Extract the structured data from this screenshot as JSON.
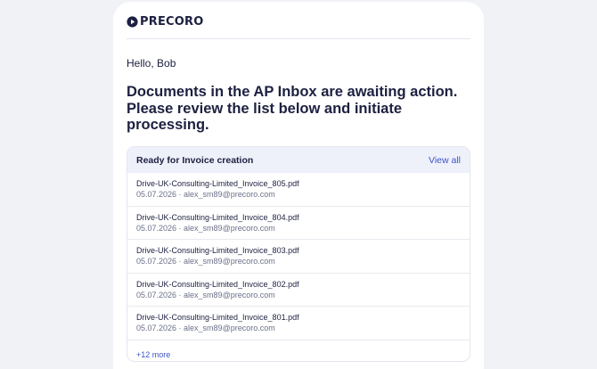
{
  "brand": {
    "name": "PRECORO",
    "logo_icon": "play-circle-icon"
  },
  "email": {
    "greeting": "Hello, Bob",
    "headline": "Documents in the AP Inbox are awaiting action. Please review the list below and initiate processing."
  },
  "panel": {
    "title": "Ready for Invoice creation",
    "view_all_label": "View all",
    "documents": [
      {
        "name": "Drive-UK-Consulting-Limited_Invoice_805.pdf",
        "meta": "05.07.2026 · alex_sm89@precoro.com"
      },
      {
        "name": "Drive-UK-Consulting-Limited_Invoice_804.pdf",
        "meta": "05.07.2026 · alex_sm89@precoro.com"
      },
      {
        "name": "Drive-UK-Consulting-Limited_Invoice_803.pdf",
        "meta": "05.07.2026 · alex_sm89@precoro.com"
      },
      {
        "name": "Drive-UK-Consulting-Limited_Invoice_802.pdf",
        "meta": "05.07.2026 · alex_sm89@precoro.com"
      },
      {
        "name": "Drive-UK-Consulting-Limited_Invoice_801.pdf",
        "meta": "05.07.2026 · alex_sm89@precoro.com"
      }
    ],
    "more_label": "+12 more"
  },
  "colors": {
    "text": "#1d2040",
    "link": "#3c54c7",
    "panel_header_bg": "#eef0fa",
    "page_bg": "#f1f2f6"
  }
}
